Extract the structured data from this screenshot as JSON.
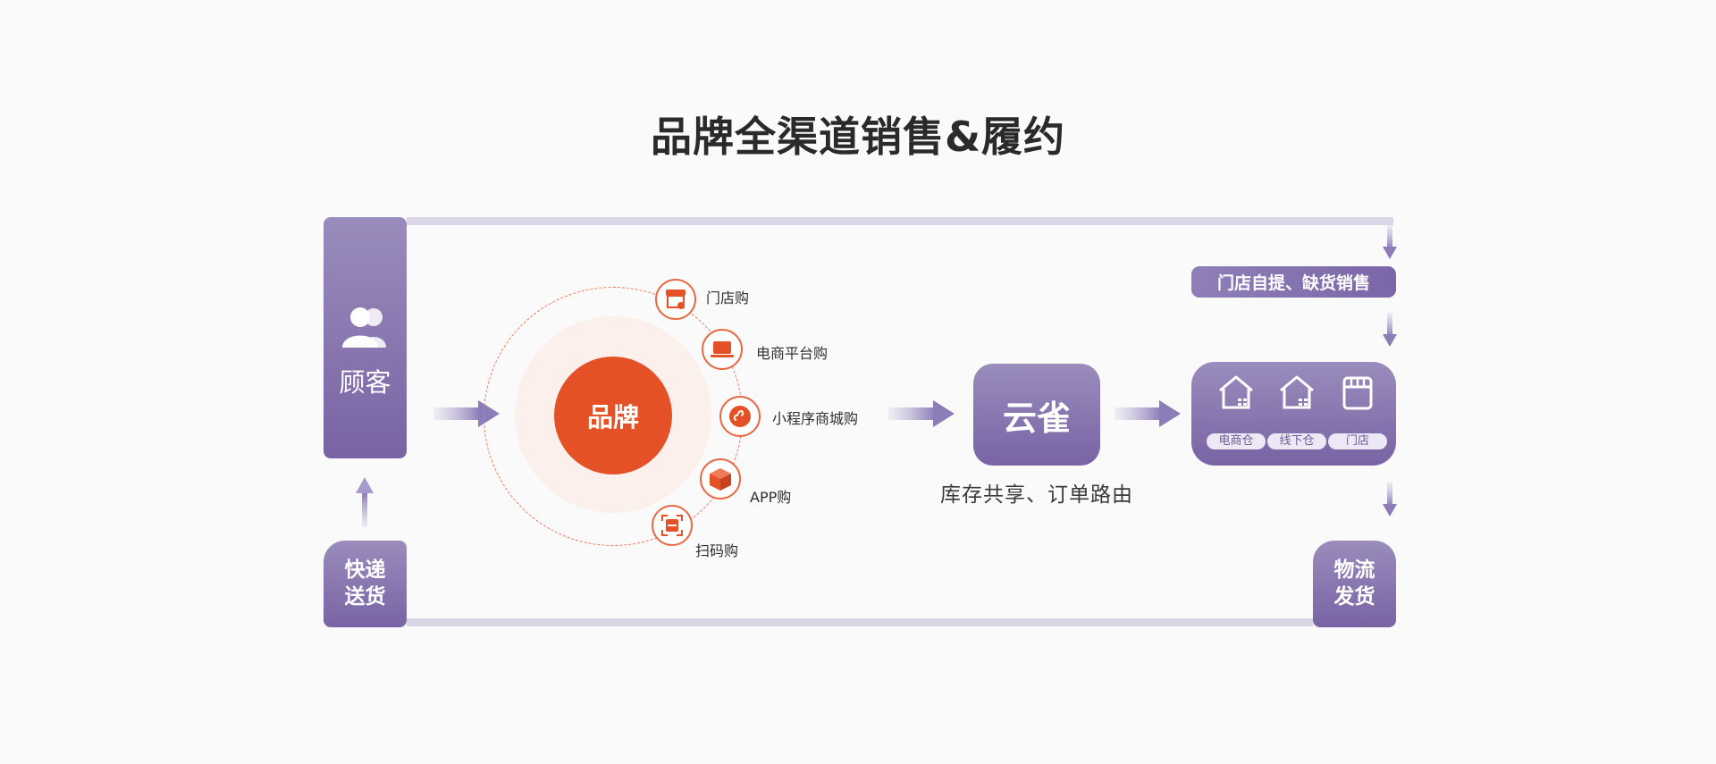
{
  "title": "品牌全渠道销售&履约",
  "customer": {
    "label": "顾客",
    "icon": "users-icon"
  },
  "express": {
    "line1": "快递",
    "line2": "送货"
  },
  "logistics": {
    "line1": "物流",
    "line2": "发货"
  },
  "brand": {
    "label": "品牌"
  },
  "channels": [
    {
      "label": "门店购",
      "icon": "store-icon"
    },
    {
      "label": "电商平台购",
      "icon": "laptop-icon"
    },
    {
      "label": "小程序商城购",
      "icon": "mini-program-icon"
    },
    {
      "label": "APP购",
      "icon": "box-icon"
    },
    {
      "label": "扫码购",
      "icon": "scan-icon"
    }
  ],
  "yunque": {
    "label": "云雀",
    "subtitle": "库存共享、订单路由"
  },
  "pickup": {
    "label": "门店自提、缺货销售"
  },
  "warehouses": [
    {
      "label": "电商仓",
      "icon": "warehouse-icon"
    },
    {
      "label": "线下仓",
      "icon": "warehouse-icon"
    },
    {
      "label": "门店",
      "icon": "shop-icon"
    }
  ],
  "colors": {
    "accent": "#e55127",
    "purple": "#7963a4",
    "track": "#d9d6e6"
  }
}
